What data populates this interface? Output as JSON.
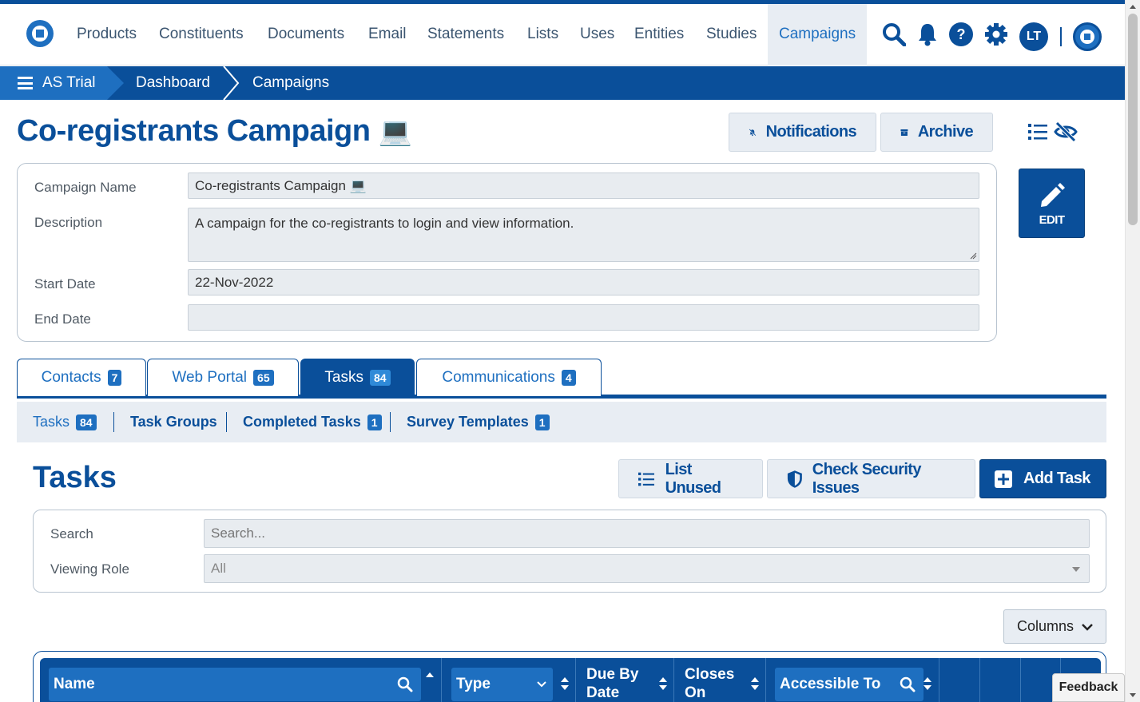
{
  "nav": {
    "items": [
      "Products",
      "Constituents",
      "Documents",
      "Email",
      "Statements",
      "Lists",
      "Uses",
      "Entities",
      "Studies",
      "Campaigns"
    ],
    "active": "Campaigns",
    "avatar_initials": "LT"
  },
  "breadcrumb": {
    "items": [
      "AS Trial",
      "Dashboard",
      "Campaigns"
    ]
  },
  "page": {
    "title": "Co-registrants Campaign",
    "title_emoji": "💻",
    "notifications_label": "Notifications",
    "archive_label": "Archive",
    "edit_label": "EDIT"
  },
  "form": {
    "campaign_name_label": "Campaign Name",
    "campaign_name_value": "Co-registrants Campaign 💻",
    "description_label": "Description",
    "description_value": "A campaign for the co-registrants to login and view information.",
    "start_date_label": "Start Date",
    "start_date_value": "22-Nov-2022",
    "end_date_label": "End Date",
    "end_date_value": ""
  },
  "tabs": [
    {
      "label": "Contacts",
      "count": "7"
    },
    {
      "label": "Web Portal",
      "count": "65"
    },
    {
      "label": "Tasks",
      "count": "84"
    },
    {
      "label": "Communications",
      "count": "4"
    }
  ],
  "subtabs": [
    {
      "label": "Tasks",
      "count": "84"
    },
    {
      "label": "Task Groups",
      "count": ""
    },
    {
      "label": "Completed Tasks",
      "count": "1"
    },
    {
      "label": "Survey Templates",
      "count": "1"
    }
  ],
  "tasks": {
    "title": "Tasks",
    "list_unused_label": "List Unused",
    "check_security_label": "Check Security Issues",
    "add_task_label": "Add Task",
    "search_label": "Search",
    "search_placeholder": "Search...",
    "viewing_role_label": "Viewing Role",
    "viewing_role_value": "All",
    "columns_label": "Columns"
  },
  "table": {
    "headers": [
      "Name",
      "Type",
      "Due By Date",
      "Closes On",
      "Accessible To"
    ],
    "due_line1": "Due By",
    "due_line2": "Date",
    "closes_line1": "Closes",
    "closes_line2": "On"
  },
  "feedback_label": "Feedback",
  "colors": {
    "primary": "#0a4f9a",
    "accent": "#1e6fc0",
    "light_bg": "#e8edf3"
  }
}
